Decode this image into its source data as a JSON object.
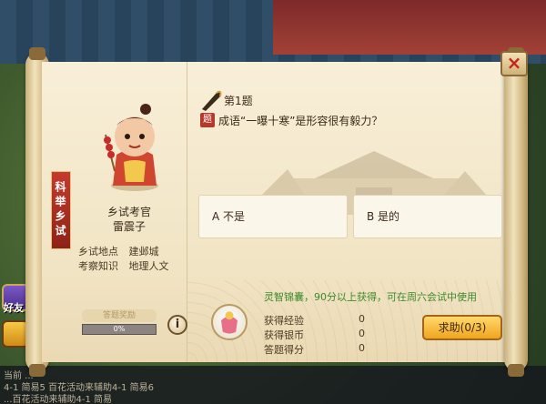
{
  "panel": {
    "vertical_tag": "科举乡试",
    "examiner_title": "乡试考官",
    "examiner_name": "雷震子",
    "location_label": "乡试地点",
    "location_value": "建邺城",
    "knowledge_label": "考察知识",
    "knowledge_value": "地理人文",
    "progress_badge": "答题奖励",
    "progress_text": "0%",
    "progress_fraction": 0.0,
    "info_button_label": "i"
  },
  "question": {
    "number_label": "第1题",
    "icon_label": "题",
    "text": "成语“一曝十寒”是形容很有毅力？"
  },
  "answers": [
    {
      "label": "A 不是"
    },
    {
      "label": "B 是的"
    }
  ],
  "reward": {
    "title": "灵智锦囊，90分以上获得，可在周六会试中使用",
    "rows": [
      {
        "label": "获得经验",
        "value": "0"
      },
      {
        "label": "获得银币",
        "value": "0"
      },
      {
        "label": "答题得分",
        "value": "0"
      }
    ],
    "help_button_label": "求助(0/3)"
  },
  "close_label": "×",
  "sidebar": {
    "friends_label": "好友"
  },
  "chat": {
    "lines": [
      "当前 ...",
      "4-1 简易5 百花活动来辅助4-1 简易6",
      "...百花活动来辅助4-1 简易"
    ]
  }
}
